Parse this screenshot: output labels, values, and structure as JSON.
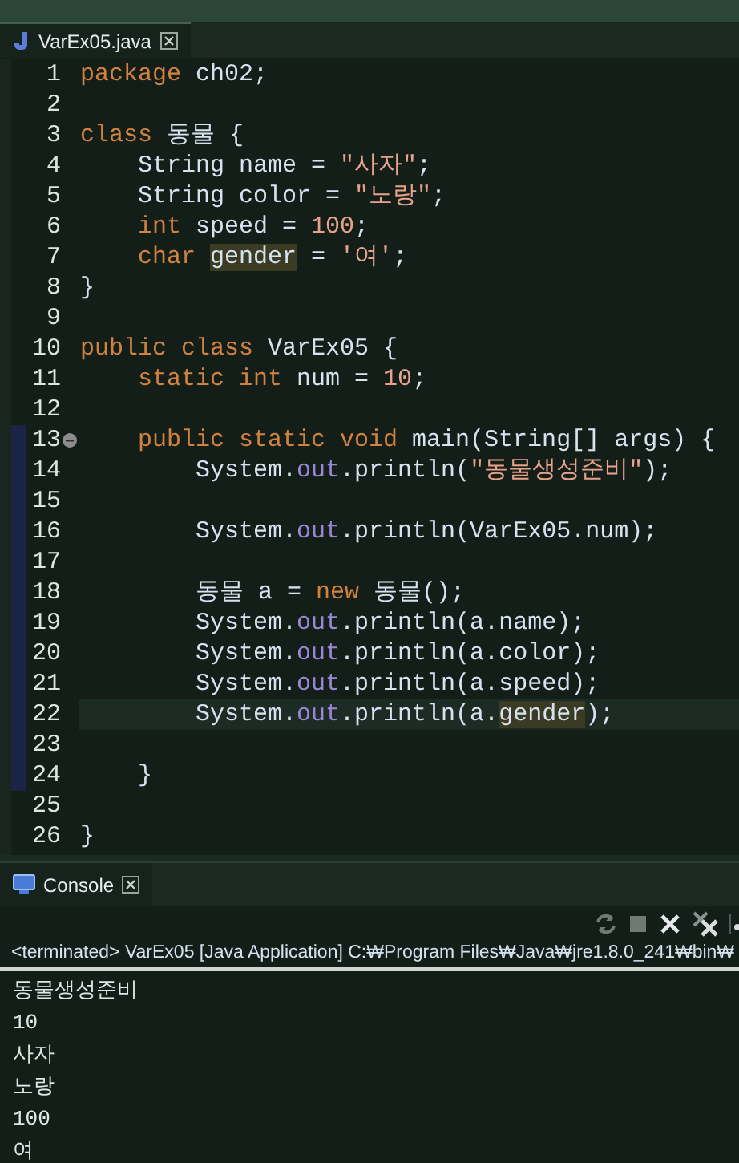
{
  "editor": {
    "tab": {
      "title": "VarEx05.java",
      "selected": true
    },
    "lines": [
      {
        "number": "1",
        "current": false,
        "fold": false,
        "range": false,
        "tokens": [
          {
            "t": "package",
            "kind": "kw"
          },
          {
            "t": " ch02;",
            "kind": "plain"
          }
        ]
      },
      {
        "number": "2",
        "current": false,
        "fold": false,
        "range": false
      },
      {
        "number": "3",
        "current": false,
        "fold": false,
        "range": false,
        "tokens": [
          {
            "t": "class",
            "kind": "kw"
          },
          {
            "t": " 동물 {",
            "kind": "plain"
          }
        ]
      },
      {
        "number": "4",
        "current": false,
        "fold": false,
        "range": false,
        "tokens": [
          {
            "t": "    String name = ",
            "kind": "plain"
          },
          {
            "t": "\"사자\"",
            "kind": "str"
          },
          {
            "t": ";",
            "kind": "plain"
          }
        ]
      },
      {
        "number": "5",
        "current": false,
        "fold": false,
        "range": false,
        "tokens": [
          {
            "t": "    String color = ",
            "kind": "plain"
          },
          {
            "t": "\"노랑\"",
            "kind": "str"
          },
          {
            "t": ";",
            "kind": "plain"
          }
        ]
      },
      {
        "number": "6",
        "current": false,
        "fold": false,
        "range": false,
        "tokens": [
          {
            "t": "    int",
            "kind": "kw"
          },
          {
            "t": " speed = ",
            "kind": "plain"
          },
          {
            "t": "100",
            "kind": "num"
          },
          {
            "t": ";",
            "kind": "plain"
          }
        ]
      },
      {
        "number": "7",
        "current": false,
        "fold": false,
        "range": false,
        "tokens": [
          {
            "t": "    char ",
            "kind": "kw"
          },
          {
            "t": "gender",
            "kind": "mark"
          },
          {
            "t": " = ",
            "kind": "plain"
          },
          {
            "t": "'여'",
            "kind": "str"
          },
          {
            "t": ";",
            "kind": "plain"
          }
        ]
      },
      {
        "number": "8",
        "current": false,
        "fold": false,
        "range": false,
        "tokens": [
          {
            "t": "}",
            "kind": "plain"
          }
        ]
      },
      {
        "number": "9",
        "current": false,
        "fold": false,
        "range": false
      },
      {
        "number": "10",
        "current": false,
        "fold": false,
        "range": false,
        "tokens": [
          {
            "t": "public class",
            "kind": "kw"
          },
          {
            "t": " VarEx05 {",
            "kind": "plain"
          }
        ]
      },
      {
        "number": "11",
        "current": false,
        "fold": false,
        "range": false,
        "tokens": [
          {
            "t": "    static int",
            "kind": "kw"
          },
          {
            "t": " num = ",
            "kind": "plain"
          },
          {
            "t": "10",
            "kind": "num"
          },
          {
            "t": ";",
            "kind": "plain"
          }
        ]
      },
      {
        "number": "12",
        "current": false,
        "fold": false,
        "range": false
      },
      {
        "number": "13",
        "current": false,
        "fold": true,
        "range": true,
        "tokens": [
          {
            "t": "    public static void",
            "kind": "kw"
          },
          {
            "t": " main(String[] args) {",
            "kind": "plain"
          }
        ]
      },
      {
        "number": "14",
        "current": false,
        "fold": false,
        "range": true,
        "tokens": [
          {
            "t": "        System.",
            "kind": "plain"
          },
          {
            "t": "out",
            "kind": "field"
          },
          {
            "t": ".println(",
            "kind": "plain"
          },
          {
            "t": "\"동물생성준비\"",
            "kind": "str"
          },
          {
            "t": ");",
            "kind": "plain"
          }
        ]
      },
      {
        "number": "15",
        "current": false,
        "fold": false,
        "range": true
      },
      {
        "number": "16",
        "current": false,
        "fold": false,
        "range": true,
        "tokens": [
          {
            "t": "        System.",
            "kind": "plain"
          },
          {
            "t": "out",
            "kind": "field"
          },
          {
            "t": ".println(VarEx05.num);",
            "kind": "plain"
          }
        ]
      },
      {
        "number": "17",
        "current": false,
        "fold": false,
        "range": true
      },
      {
        "number": "18",
        "current": false,
        "fold": false,
        "range": true,
        "tokens": [
          {
            "t": "        동물 a = ",
            "kind": "plain"
          },
          {
            "t": "new",
            "kind": "kw"
          },
          {
            "t": " 동물();",
            "kind": "plain"
          }
        ]
      },
      {
        "number": "19",
        "current": false,
        "fold": false,
        "range": true,
        "tokens": [
          {
            "t": "        System.",
            "kind": "plain"
          },
          {
            "t": "out",
            "kind": "field"
          },
          {
            "t": ".println(a.name);",
            "kind": "plain"
          }
        ]
      },
      {
        "number": "20",
        "current": false,
        "fold": false,
        "range": true,
        "tokens": [
          {
            "t": "        System.",
            "kind": "plain"
          },
          {
            "t": "out",
            "kind": "field"
          },
          {
            "t": ".println(a.color);",
            "kind": "plain"
          }
        ]
      },
      {
        "number": "21",
        "current": false,
        "fold": false,
        "range": true,
        "tokens": [
          {
            "t": "        System.",
            "kind": "plain"
          },
          {
            "t": "out",
            "kind": "field"
          },
          {
            "t": ".println(a.speed);",
            "kind": "plain"
          }
        ]
      },
      {
        "number": "22",
        "current": true,
        "fold": false,
        "range": true,
        "tokens": [
          {
            "t": "        System.",
            "kind": "plain"
          },
          {
            "t": "out",
            "kind": "field"
          },
          {
            "t": ".println(a.",
            "kind": "plain"
          },
          {
            "t": "gender",
            "kind": "mark"
          },
          {
            "t": ");",
            "kind": "plain"
          }
        ]
      },
      {
        "number": "23",
        "current": false,
        "fold": false,
        "range": true
      },
      {
        "number": "24",
        "current": false,
        "fold": false,
        "range": true,
        "tokens": [
          {
            "t": "    }",
            "kind": "plain"
          }
        ]
      },
      {
        "number": "25",
        "current": false,
        "fold": false,
        "range": false
      },
      {
        "number": "26",
        "current": false,
        "fold": false,
        "range": false,
        "tokens": [
          {
            "t": "}",
            "kind": "plain"
          }
        ]
      }
    ]
  },
  "console": {
    "tab": {
      "title": "Console",
      "selected": true
    },
    "status": "<terminated> VarEx05 [Java Application] C:₩Program Files₩Java₩jre1.8.0_241₩bin₩",
    "output": [
      "동물생성준비",
      "10",
      "사자",
      "노랑",
      "100",
      "여"
    ]
  }
}
